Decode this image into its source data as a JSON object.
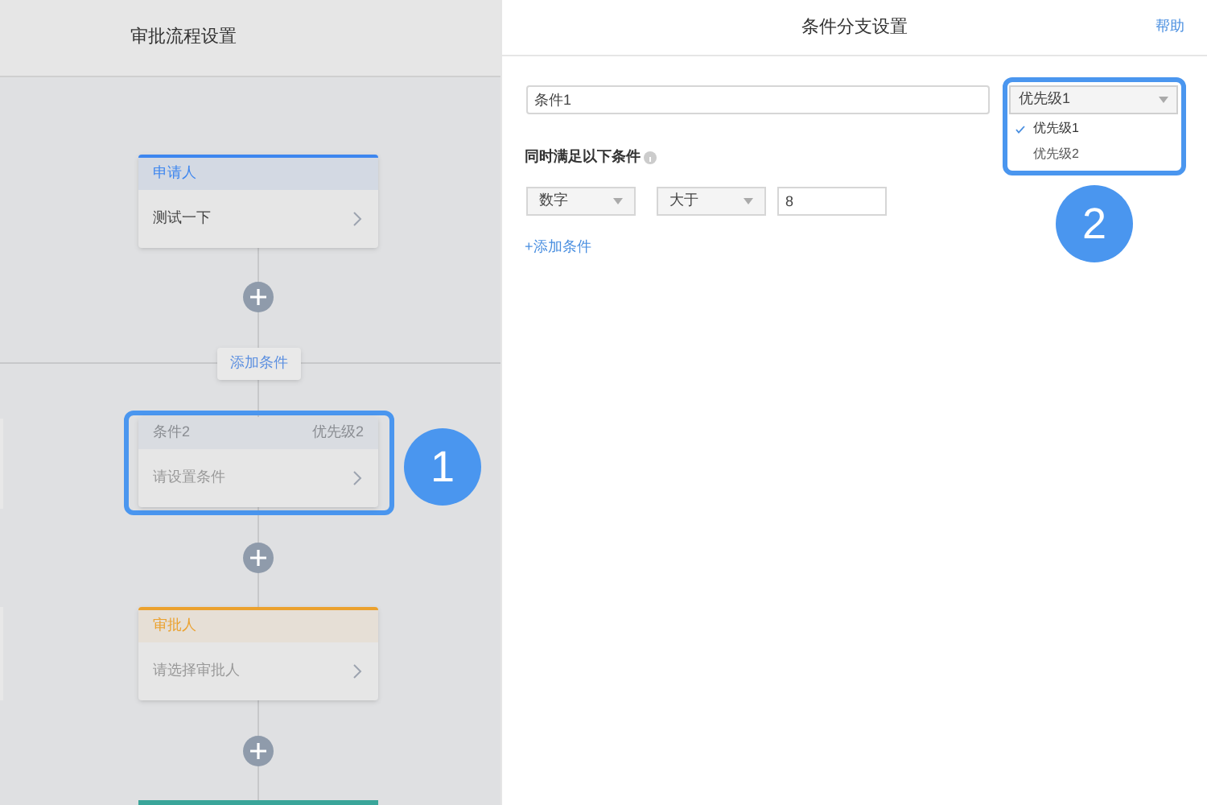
{
  "flow_panel": {
    "title": "审批流程设置",
    "nodes": [
      {
        "kind": "applicant",
        "title": "申请人",
        "content": "测试一下",
        "color": "#3d86ef",
        "highlighted": false
      },
      {
        "kind": "condition",
        "title": "条件2",
        "priority": "优先级2",
        "content": "请设置条件",
        "highlighted": true
      },
      {
        "kind": "approver",
        "title": "审批人",
        "content": "请选择审批人",
        "color": "#eba12e",
        "highlighted": false
      }
    ],
    "add_condition_button": "添加条件"
  },
  "callouts": [
    {
      "label": "1"
    },
    {
      "label": "2"
    }
  ],
  "settings_panel": {
    "title": "条件分支设置",
    "help_link": "帮助",
    "name_input": {
      "value": "条件1"
    },
    "priority_select": {
      "value": "优先级1",
      "expanded": true,
      "options": [
        {
          "label": "优先级1",
          "selected": true
        },
        {
          "label": "优先级2",
          "selected": false
        }
      ]
    },
    "section_label": "同时满足以下条件",
    "conditions": [
      {
        "field": "数字",
        "operator": "大于",
        "value": "8"
      }
    ],
    "add_condition_link": "+添加条件"
  }
}
